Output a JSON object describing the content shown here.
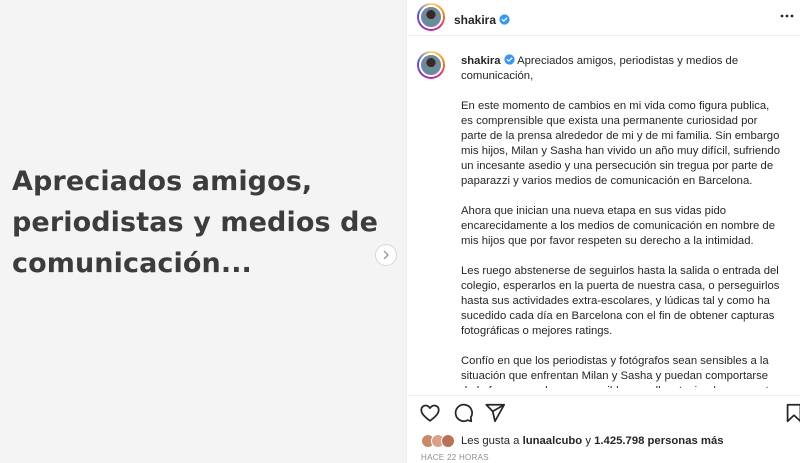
{
  "media": {
    "text": "Apreciados amigos, periodistas y  medios de comunicación...",
    "lines": [
      "Apreciados amigos,",
      "periodistas y  medios de",
      "comunicación..."
    ]
  },
  "header": {
    "username": "shakira"
  },
  "caption": {
    "username": "shakira",
    "paragraphs": [
      "Apreciados amigos, periodistas y medios de comunicación,",
      "En este momento de cambios en mi vida como figura publica, es comprensible que exista una permanente curiosidad por parte de la prensa alrededor de mi y de mi familia. Sin embargo mis hijos, Milan y Sasha han vivido un año muy difícil, sufriendo un incesante asedio y una persecución sin tregua por parte de paparazzi y varios medios de comunicación en Barcelona.",
      "Ahora que inician una nueva etapa en sus vidas pido encarecidamente a los medios de comunicación en nombre de mis hijos que por favor respeten su derecho a la intimidad.",
      "Les ruego abstenerse de seguirlos hasta la salida o entrada del colegio, esperarlos en la puerta de nuestra casa, o perseguirlos hasta sus actividades extra-escolares, y lúdicas tal y como ha sucedido cada día en Barcelona con el fin de obtener capturas fotográficas o mejores ratings.",
      "Confío en que los periodistas y fotógrafos sean sensibles a la situación que enfrentan Milan y Sasha y puedan comportarse de la forma mas humana posible con ellos, teniendo en cuenta que"
    ]
  },
  "likes": {
    "prefix": "Les gusta a",
    "user": "lunaalcubo",
    "connector": "y",
    "count": "1.425.798 personas más"
  },
  "timestamp": "HACE 22 HORAS",
  "colors": {
    "verified": "#3897f0",
    "text": "#262626",
    "muted": "#8e8e8e"
  }
}
